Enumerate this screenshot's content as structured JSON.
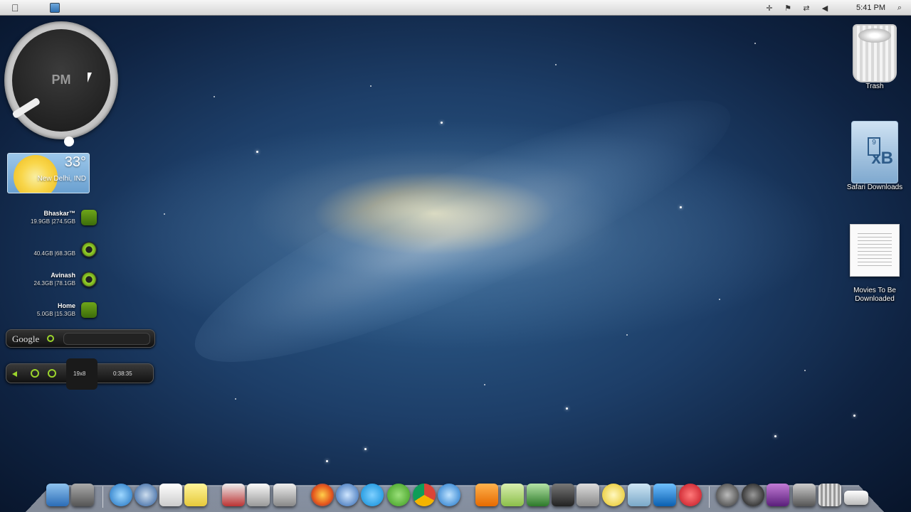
{
  "menubar": {
    "time": "5:41 PM",
    "icons": [
      "apple-icon",
      "finder-icon",
      "plus-icon",
      "flag-icon",
      "network-icon",
      "volume-icon",
      "spotlight-icon"
    ]
  },
  "clock_widget": {
    "period": "PM"
  },
  "weather": {
    "temperature": "33°",
    "location": "New Delhi, IND"
  },
  "drives": [
    {
      "name": "Bhaskar™",
      "usage": "19.9GB |274.5GB"
    },
    {
      "name": "",
      "usage": "40.4GB |68.3GB"
    },
    {
      "name": "Avinash",
      "usage": "24.3GB |78.1GB"
    },
    {
      "name": "Home",
      "usage": "5.0GB |15.3GB"
    }
  ],
  "google_search": {
    "label": "Google",
    "value": ""
  },
  "system_bar": {
    "left_value": "19x8",
    "right_value": "0:38:35"
  },
  "desktop_icons": [
    {
      "label": "Trash"
    },
    {
      "label": "Safari Downloads"
    },
    {
      "label": "Movies To Be Downloaded"
    }
  ],
  "colors": {
    "accent": "#9bd42c",
    "menubar": "#e6e6e6"
  },
  "dock": {
    "items": [
      "finder-icon",
      "system-preferences-icon",
      "quicktime-icon",
      "safari-icon",
      "notes-icon",
      "stickies-icon",
      "photo-icon",
      "document-icon",
      "screen-share-icon",
      "firefox-icon",
      "globe-icon",
      "skype-icon",
      "utorrent-icon",
      "chrome-icon",
      "itunes-icon",
      "vlc-icon",
      "maps-icon",
      "gif-icon",
      "film-icon",
      "pen-icon",
      "disc-icon",
      "info-icon",
      "teamviewer-icon",
      "mcafee-icon",
      "bird-icon",
      "power-icon",
      "photo-booth-icon",
      "monitor-icon",
      "trash-icon",
      "desktop-icon"
    ]
  }
}
